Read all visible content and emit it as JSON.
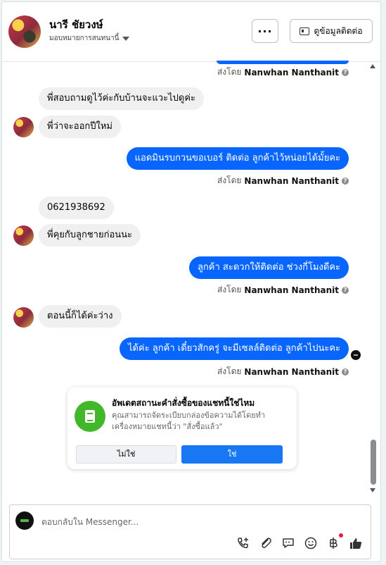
{
  "header": {
    "contact_name": "นารี ชัยวงษ์",
    "assign_label": "มอบหมายการสนทนานี้",
    "more_label": "···",
    "view_contact_label": "ดูข้อมูลติดต่อ"
  },
  "messages": [
    {
      "type": "sentby",
      "prefix": "ส่งโดย",
      "name": "Nanwhan Nanthanit"
    },
    {
      "type": "in",
      "text": "พี่สอบถามดูไว้ค่ะกับบ้านจะแวะไปดูค่ะ"
    },
    {
      "type": "in",
      "text": "พี่ว่าจะออกปีใหม่"
    },
    {
      "type": "out",
      "text": "แอดมินรบกวนขอเบอร์ ติดต่อ ลูกค้าไว้หน่อยได้มั้ยคะ"
    },
    {
      "type": "sentby",
      "prefix": "ส่งโดย",
      "name": "Nanwhan Nanthanit"
    },
    {
      "type": "in",
      "text": "0621938692"
    },
    {
      "type": "in",
      "text": "พี่คุยกับลูกชายก่อนนะ"
    },
    {
      "type": "out",
      "text": "ลูกค้า สะดวกให้ติดต่อ ช่วงกี่โมงดีคะ"
    },
    {
      "type": "sentby",
      "prefix": "ส่งโดย",
      "name": "Nanwhan Nanthanit"
    },
    {
      "type": "in",
      "text": "ตอนนี้ก็ได้ค่ะว่าง"
    },
    {
      "type": "out",
      "text": "ได้ค่ะ ลูกค้า เดี๋ยวสักครู่ จะมีเซลล์ติดต่อ ลูกค้าไปนะคะ"
    },
    {
      "type": "sentby",
      "prefix": "ส่งโดย",
      "name": "Nanwhan Nanthanit"
    }
  ],
  "order_card": {
    "title": "อัพเดตสถานะคำสั่งซื้อของแชทนี้ใช่ไหม",
    "description": "คุณสามารถจัดระเบียบกล่องข้อความได้โดยทำเครื่องหมายแชทนี้ว่า \"สั่งซื้อแล้ว\"",
    "no_label": "ไม่ใช่",
    "yes_label": "ใช่"
  },
  "composer": {
    "placeholder": "ตอบกลับใน Messenger..."
  },
  "icons": [
    "phone-plus-icon",
    "attachment-icon",
    "quick-reply-icon",
    "emoji-icon",
    "baht-icon",
    "thumbs-up-icon"
  ],
  "colors": {
    "accent": "#0866ff",
    "green": "#42b72a",
    "button_blue": "#1877f2"
  }
}
